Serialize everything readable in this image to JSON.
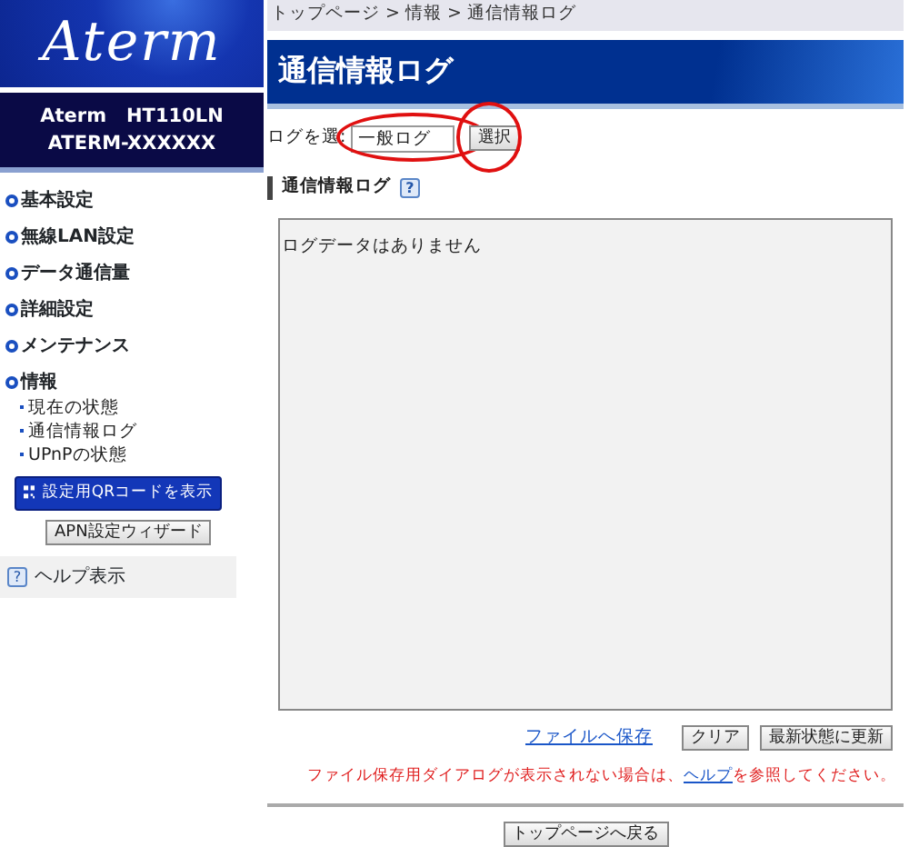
{
  "logo": "Aterm",
  "device": {
    "model": "Aterm　HT110LN",
    "name": "ATERM-XXXXXX"
  },
  "menu": [
    {
      "label": "基本設定"
    },
    {
      "label": "無線LAN設定"
    },
    {
      "label": "データ通信量"
    },
    {
      "label": "詳細設定"
    },
    {
      "label": "メンテナンス"
    },
    {
      "label": "情報",
      "children": [
        {
          "label": "現在の状態"
        },
        {
          "label": "通信情報ログ"
        },
        {
          "label": "UPnPの状態"
        }
      ]
    }
  ],
  "qr_button": "設定用QRコードを表示",
  "apn_button": "APN設定ウィザード",
  "help": {
    "icon": "?",
    "label": "ヘルプ表示"
  },
  "breadcrumb": [
    "トップページ",
    "情報",
    "通信情報ログ"
  ],
  "breadcrumb_separator": ">",
  "page_title": "通信情報ログ",
  "log_select": {
    "label": "ログを選:",
    "value": "一般ログ",
    "highlighted": true
  },
  "select_button": {
    "label": "選択",
    "highlighted": true
  },
  "section": {
    "title": "通信情報ログ",
    "help_icon": "?"
  },
  "log_text": "ログデータはありません",
  "actions": {
    "save_link": "ファイルへ保存",
    "clear_button": "クリア",
    "refresh_button": "最新状態に更新"
  },
  "note": {
    "before": "ファイル保存用ダイアログが表示されない場合は、",
    "link": "ヘルプ",
    "after": "を参照してください。"
  },
  "back_button": "トップページへ戻る"
}
